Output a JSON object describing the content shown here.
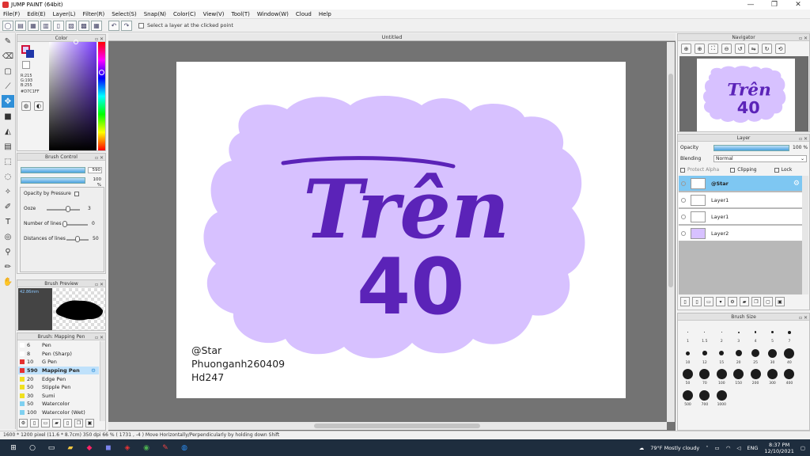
{
  "window": {
    "title": "JUMP PAINT (64bit)"
  },
  "menu": [
    "File(F)",
    "Edit(E)",
    "Layer(L)",
    "Filter(R)",
    "Select(S)",
    "Snap(N)",
    "Color(C)",
    "View(V)",
    "Tool(T)",
    "Window(W)",
    "Cloud",
    "Help"
  ],
  "toolbar": {
    "option_label": "Select a layer at the clicked point"
  },
  "color_panel": {
    "title": "Color",
    "r": "R:215",
    "g": "G:193",
    "b": "B:255",
    "hex": "#D7C1FF"
  },
  "brush_control": {
    "title": "Brush Control",
    "size_value": "590",
    "opacity_value": "100 %",
    "opacity_by_pressure": "Opacity by Pressure",
    "ooze_label": "Ooze",
    "ooze_value": "3",
    "lines_label": "Number of lines",
    "lines_value": "0",
    "distance_label": "Distances of lines",
    "distance_value": "50"
  },
  "brush_preview": {
    "title": "Brush Preview",
    "size": "42.86mm"
  },
  "brush_list": {
    "title": "Brush: Mapping Pen",
    "items": [
      {
        "size": "6",
        "name": "Pen",
        "color": "#ffffff"
      },
      {
        "size": "8",
        "name": "Pen (Sharp)",
        "color": "#ffffff"
      },
      {
        "size": "10",
        "name": "G Pen",
        "color": "#e53030"
      },
      {
        "size": "590",
        "name": "Mapping Pen",
        "color": "#e53030"
      },
      {
        "size": "20",
        "name": "Edge Pen",
        "color": "#f0e020"
      },
      {
        "size": "50",
        "name": "Stipple Pen",
        "color": "#f0e020"
      },
      {
        "size": "30",
        "name": "Sumi",
        "color": "#f0e020"
      },
      {
        "size": "50",
        "name": "Watercolor",
        "color": "#7fd0f0"
      },
      {
        "size": "100",
        "name": "Watercolor (Wet)",
        "color": "#7fd0f0"
      },
      {
        "size": "",
        "name": "",
        "color": "#7fd0f0"
      }
    ]
  },
  "document": {
    "title": "Untitled"
  },
  "artwork": {
    "headline": "Trên",
    "number": "40",
    "sig_line1": "@Star",
    "sig_line2": "Phuonganh260409",
    "sig_line3": "Hd247",
    "cloud_color": "#d7c1ff",
    "text_color": "#5b23b8"
  },
  "navigator": {
    "title": "Navigator"
  },
  "layer_panel": {
    "title": "Layer",
    "opacity_label": "Opacity",
    "opacity_value": "100 %",
    "blending_label": "Blending",
    "blending_value": "Normal",
    "protect_alpha": "Protect Alpha",
    "clipping": "Clipping",
    "lock": "Lock",
    "layers": [
      {
        "name": "@Star",
        "selected": true
      },
      {
        "name": "Layer1",
        "selected": false
      },
      {
        "name": "Layer1",
        "selected": false
      },
      {
        "name": "Layer2",
        "selected": false
      }
    ]
  },
  "brush_size": {
    "title": "Brush Size",
    "sizes": [
      "1",
      "1.5",
      "2",
      "3",
      "4",
      "5",
      "7",
      "10",
      "12",
      "15",
      "20",
      "25",
      "30",
      "40",
      "50",
      "70",
      "100",
      "150",
      "200",
      "300",
      "400",
      "500",
      "700",
      "1000"
    ]
  },
  "status": {
    "text": "1600 * 1200 pixel   (11.6 * 8.7cm)   350 dpi   66 %   ( 1731 , -4 )   Move Horizontally/Perpendicularly by holding down Shift"
  },
  "taskbar": {
    "weather": "79°F  Mostly cloudy",
    "lang": "ENG",
    "time": "8:37 PM",
    "date": "12/10/2021"
  }
}
